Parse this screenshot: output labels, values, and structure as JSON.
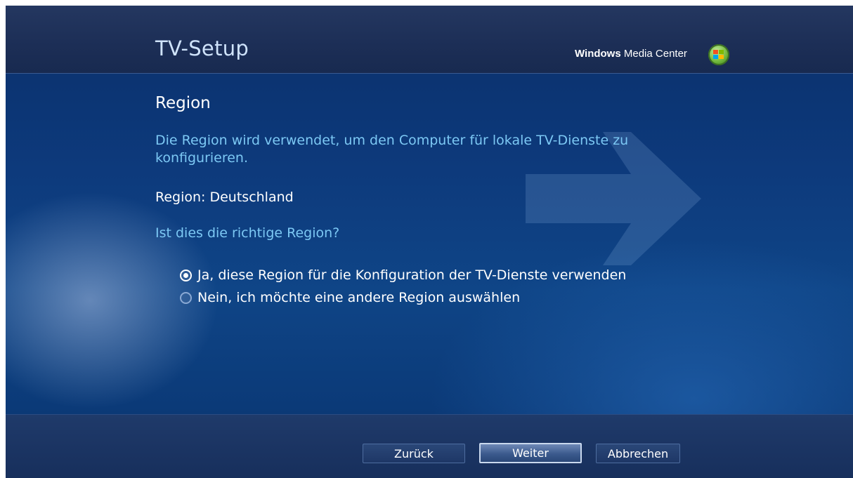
{
  "header": {
    "title": "TV-Setup",
    "brand_bold": "Windows",
    "brand_rest": " Media Center",
    "brand_icon": "windows-flag-orb-icon"
  },
  "main": {
    "heading": "Region",
    "intro": "Die Region wird verwendet, um den Computer für lokale TV-Dienste zu konfigurieren.",
    "region_line": "Region: Deutschland",
    "question": "Ist dies die richtige Region?",
    "options": [
      {
        "label": "Ja, diese Region für die Konfiguration der TV-Dienste verwenden",
        "selected": true
      },
      {
        "label": "Nein, ich möchte eine andere Region auswählen",
        "selected": false
      }
    ]
  },
  "footer": {
    "back_label": "Zurück",
    "next_label": "Weiter",
    "cancel_label": "Abbrechen"
  },
  "colors": {
    "accent_text": "#7cc8f4",
    "background_blue": "#0d3a7c"
  }
}
